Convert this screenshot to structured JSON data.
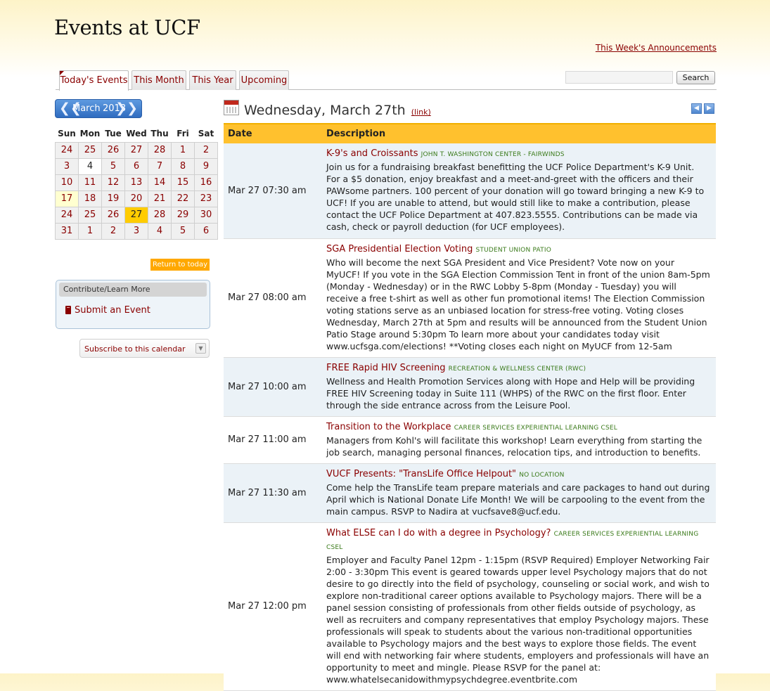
{
  "site": {
    "title": "Events at UCF",
    "announcements_link": "This Week's Announcements"
  },
  "tabs": [
    {
      "label": "Today's Events",
      "active": true
    },
    {
      "label": "This Month",
      "active": false
    },
    {
      "label": "This Year",
      "active": false
    },
    {
      "label": "Upcoming",
      "active": false
    }
  ],
  "search": {
    "value": "",
    "button_label": "Search"
  },
  "mini_calendar": {
    "prev_icon": "double-chevron-left",
    "next_icon": "double-chevron-right",
    "month": "March",
    "year": "2013",
    "weekdays": [
      "Sun",
      "Mon",
      "Tue",
      "Wed",
      "Thu",
      "Fri",
      "Sat"
    ],
    "weeks": [
      [
        "24",
        "25",
        "26",
        "27",
        "28",
        "1",
        "2"
      ],
      [
        "3",
        "4",
        "5",
        "6",
        "7",
        "8",
        "9"
      ],
      [
        "10",
        "11",
        "12",
        "13",
        "14",
        "15",
        "16"
      ],
      [
        "17",
        "18",
        "19",
        "20",
        "21",
        "22",
        "23"
      ],
      [
        "24",
        "25",
        "26",
        "27",
        "28",
        "29",
        "30"
      ],
      [
        "31",
        "1",
        "2",
        "3",
        "4",
        "5",
        "6"
      ]
    ],
    "return_today": "Return to today"
  },
  "contribute": {
    "heading": "Contribute/Learn More",
    "submit_link": "Submit an Event"
  },
  "subscribe": {
    "label": "Subscribe to this calendar"
  },
  "day": {
    "title": "Wednesday, March 27th",
    "link_label": "(link)"
  },
  "table": {
    "headers": {
      "date": "Date",
      "description": "Description"
    },
    "events": [
      {
        "date": "Mar 27 07:30 am",
        "title": "K-9's and Croissants",
        "location": "JOHN T. WASHINGTON CENTER - FAIRWINDS",
        "body": "Join us for a fundraising breakfast benefitting the UCF Police Department's K-9 Unit. For a $5 donation, enjoy breakfast and a meet-and-greet with the officers and their PAWsome partners. 100 percent of your donation will go toward bringing a new K-9 to UCF! If you are unable to attend, but would still like to make a contribution, please contact the UCF Police Department at 407.823.5555. Contributions can be made via cash, check or payroll deduction (for UCF employees)."
      },
      {
        "date": "Mar 27 08:00 am",
        "title": "SGA Presidential Election Voting",
        "location": "STUDENT UNION PATIO",
        "body": "Who will become the next SGA President and Vice President? Vote now on your MyUCF! If you vote in the SGA Election Commission Tent in front of the union 8am-5pm (Monday - Wednesday) or in the RWC Lobby 5-8pm (Monday - Tuesday) you will receive a free t-shirt as well as other fun promotional items! The Election Commission voting stations serve as an unbiased location for stress-free voting. Voting closes Wednesday, March 27th at 5pm and results will be announced from the Student Union Patio Stage around 5:30pm To learn more about your candidates today visit www.ucfsga.com/elections! **Voting closes each night on MyUCF from 12-5am"
      },
      {
        "date": "Mar 27 10:00 am",
        "title": "FREE Rapid HIV Screening",
        "location": "RECREATION & WELLNESS CENTER (RWC)",
        "body": "Wellness and Health Promotion Services along with Hope and Help will be providing FREE HIV Screening today in Suite 111 (WHPS) of the RWC on the first floor. Enter through the side entrance across from the Leisure Pool."
      },
      {
        "date": "Mar 27 11:00 am",
        "title": "Transition to the Workplace",
        "location": "CAREER SERVICES EXPERIENTIAL LEARNING CSEL",
        "body": "Managers from Kohl's will facilitate this workshop! Learn everything from starting the job search, managing personal finances, relocation tips, and introduction to benefits."
      },
      {
        "date": "Mar 27 11:30 am",
        "title": "VUCF Presents: \"TransLife Office Helpout\"",
        "location": "NO LOCATION",
        "body": "Come help the TransLife team prepare materials and care packages to hand out during April which is National Donate Life Month! We will be carpooling to the event from the main campus. RSVP to Nadira at vucfsave8@ucf.edu."
      },
      {
        "date": "Mar 27 12:00 pm",
        "title": "What ELSE can I do with a degree in Psychology?",
        "location": "CAREER SERVICES EXPERIENTIAL LEARNING CSEL",
        "body": "Employer and Faculty Panel 12pm - 1:15pm (RSVP Required) Employer Networking Fair 2:00 - 3:30pm This event is geared towards upper level Psychology majors that do not desire to go directly into the field of psychology, counseling or social work, and wish to explore non-traditional career options available to Psychology majors. There will be a panel session consisting of professionals from other fields outside of psychology, as well as recruiters and company representatives that employ Psychology majors. These professionals will speak to students about the various non-traditional opportunities available to Psychology majors and the best ways to explore those fields. The event will end with networking fair where students, employers and professionals will have an opportunity to meet and mingle. Please RSVP for the panel at: www.whatelsecanidowithmypsychdegree.eventbrite.com"
      }
    ]
  },
  "colors": {
    "link": "#8a0000",
    "table_header": "#ffc12e",
    "selected_day": "#ffcc00",
    "return_today": "#ffa800",
    "calendar_header": "#3a77c8"
  }
}
